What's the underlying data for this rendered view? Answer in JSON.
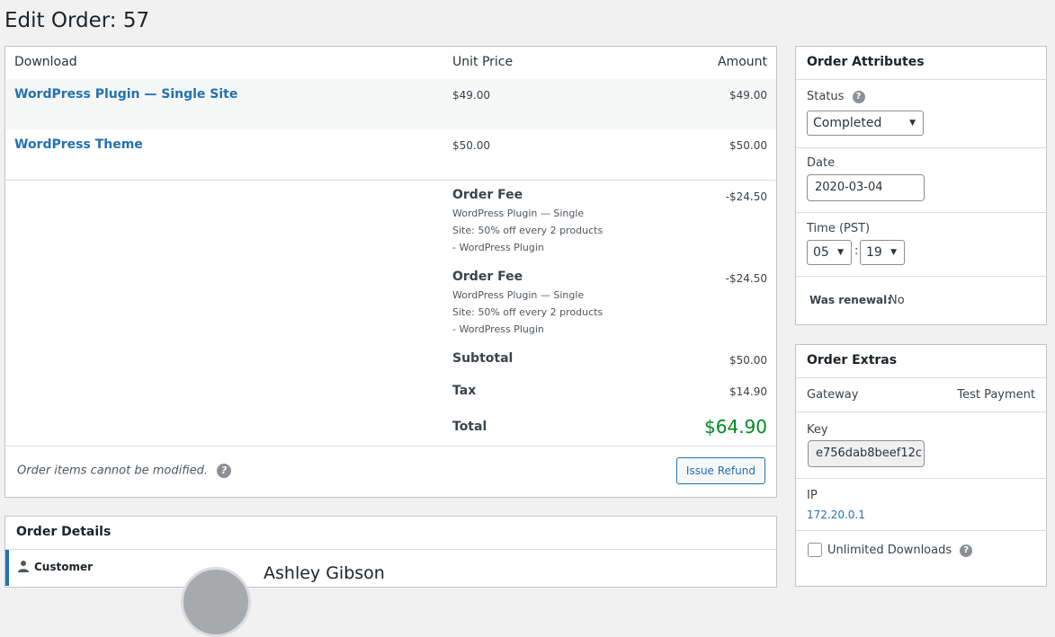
{
  "page": {
    "title": "Edit Order: 57"
  },
  "items": {
    "headers": {
      "download": "Download",
      "unit_price": "Unit Price",
      "amount": "Amount"
    },
    "rows": [
      {
        "name": "WordPress Plugin — Single Site",
        "unit_price": "$49.00",
        "amount": "$49.00"
      },
      {
        "name": "WordPress Theme",
        "unit_price": "$50.00",
        "amount": "$50.00"
      }
    ],
    "fees": [
      {
        "title": "Order Fee",
        "description": "WordPress Plugin — Single\nSite:  50% off every 2 products\n- WordPress Plugin",
        "amount": "-$24.50"
      },
      {
        "title": "Order Fee",
        "description": "WordPress Plugin — Single\nSite:  50% off every 2 products\n- WordPress Plugin",
        "amount": "-$24.50"
      }
    ],
    "subtotal": {
      "label": "Subtotal",
      "value": "$50.00"
    },
    "tax": {
      "label": "Tax",
      "value": "$14.90"
    },
    "total": {
      "label": "Total",
      "value": "$64.90"
    },
    "note": "Order items cannot be modified.",
    "refund_button": "Issue Refund"
  },
  "order_details": {
    "title": "Order Details",
    "tab_customer": "Customer",
    "customer_name": "Ashley Gibson"
  },
  "attributes": {
    "title": "Order Attributes",
    "status_label": "Status",
    "status_value": "Completed",
    "date_label": "Date",
    "date_value": "2020-03-04",
    "time_label": "Time (PST)",
    "hour": "05",
    "minute": "19",
    "renewal_label": "Was renewal:",
    "renewal_value": "No"
  },
  "extras": {
    "title": "Order Extras",
    "gateway_label": "Gateway",
    "gateway_value": "Test Payment",
    "key_label": "Key",
    "key_value": "e756dab8beef12c",
    "ip_label": "IP",
    "ip_value": "172.20.0.1",
    "unlimited_label": "Unlimited Downloads"
  }
}
